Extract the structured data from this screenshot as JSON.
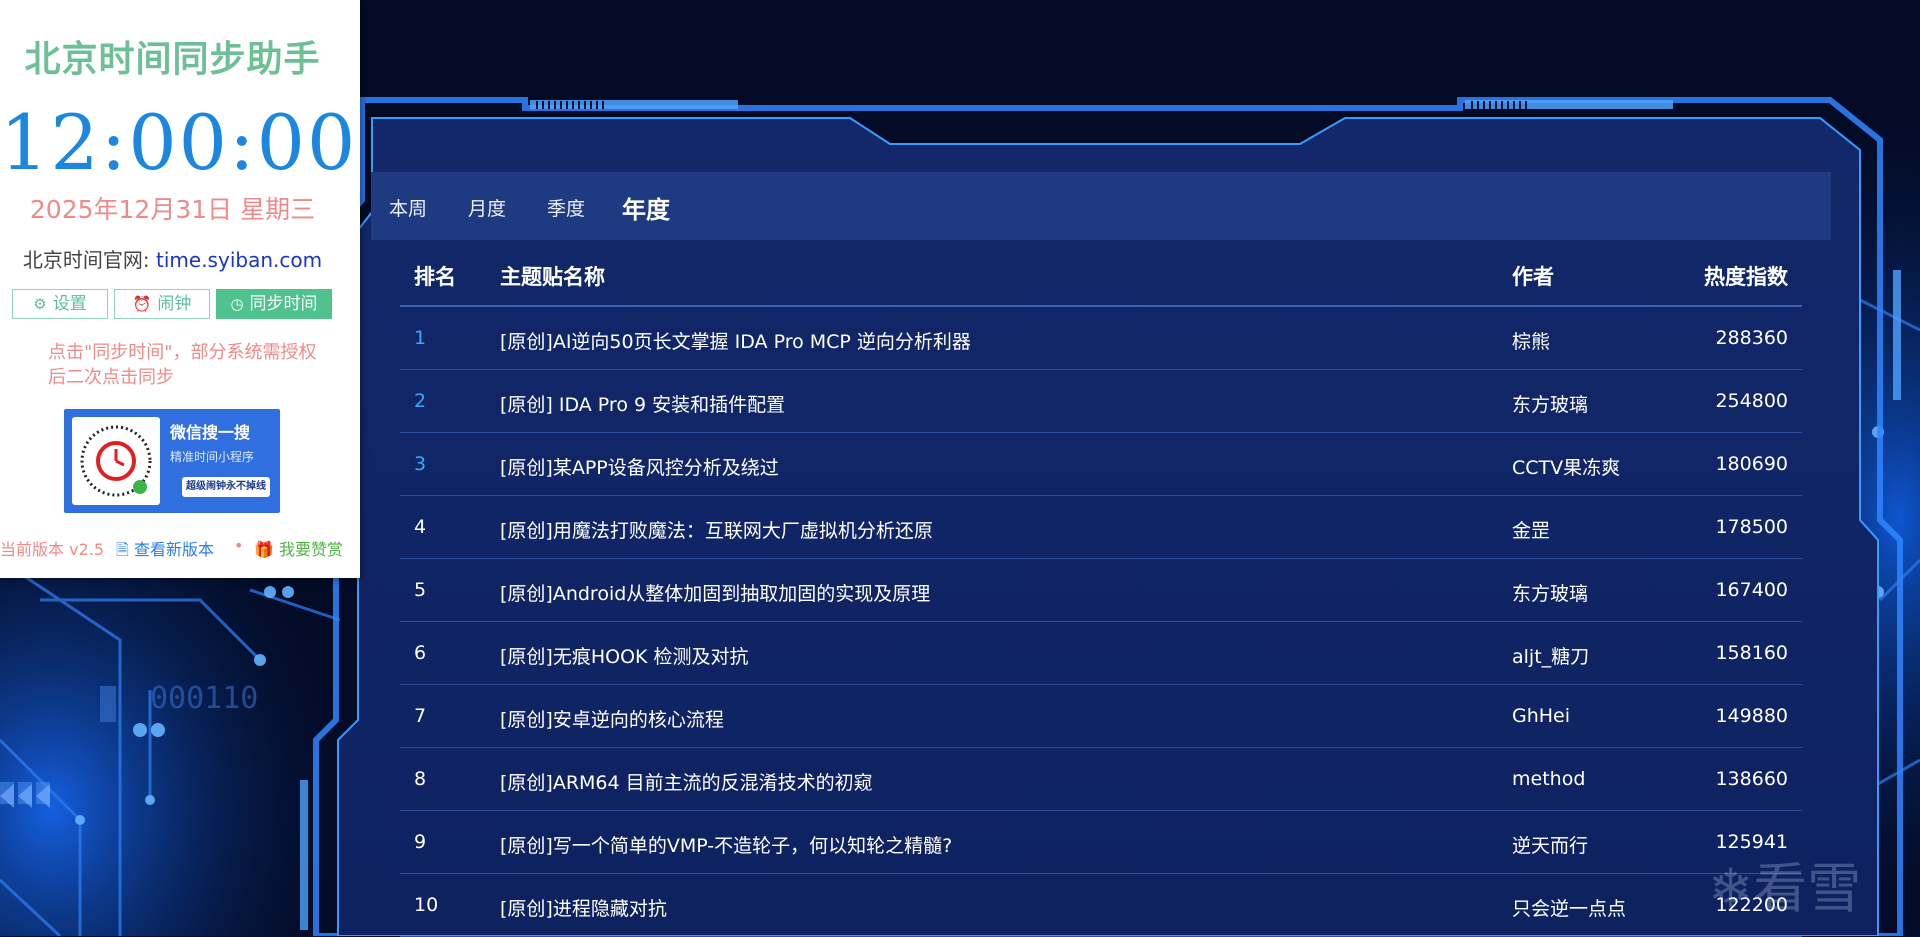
{
  "clock": {
    "title": "北京时间同步助手",
    "time": "12:00:00",
    "date": "2025年12月31日 星期三",
    "site_label": "北京时间官网: ",
    "site_link": "time.syiban.com",
    "buttons": {
      "settings": "设置",
      "alarm": "闹钟",
      "sync": "同步时间"
    },
    "note": "点击\"同步时间\"，部分系统需授权后二次点击同步",
    "qr": {
      "title": "微信搜一搜",
      "subtitle": "精准时间小程序",
      "badge": "超级闹钟永不掉线"
    },
    "footer": {
      "version": "当前版本 v2.5",
      "new_version": "查看新版本",
      "dot": "•",
      "donate": "我要赞赏"
    }
  },
  "tabs": [
    {
      "label": "本周",
      "active": false
    },
    {
      "label": "月度",
      "active": false
    },
    {
      "label": "季度",
      "active": false
    },
    {
      "label": "年度",
      "active": true
    }
  ],
  "table": {
    "headers": {
      "rank": "排名",
      "title": "主题贴名称",
      "author": "作者",
      "heat": "热度指数"
    },
    "rows": [
      {
        "rank": "1",
        "title": "[原创]AI逆向50页长文掌握 IDA Pro MCP 逆向分析利器",
        "author": "棕熊",
        "heat": "288360"
      },
      {
        "rank": "2",
        "title": "[原创] IDA Pro 9 安装和插件配置",
        "author": "东方玻璃",
        "heat": "254800"
      },
      {
        "rank": "3",
        "title": "[原创]某APP设备风控分析及绕过",
        "author": "CCTV果冻爽",
        "heat": "180690"
      },
      {
        "rank": "4",
        "title": "[原创]用魔法打败魔法：互联网大厂虚拟机分析还原",
        "author": "金罡",
        "heat": "178500"
      },
      {
        "rank": "5",
        "title": "[原创]Android从整体加固到抽取加固的实现及原理",
        "author": "东方玻璃",
        "heat": "167400"
      },
      {
        "rank": "6",
        "title": "[原创]无痕HOOK 检测及对抗",
        "author": "aljt_糖刀",
        "heat": "158160"
      },
      {
        "rank": "7",
        "title": "[原创]安卓逆向的核心流程",
        "author": "GhHei",
        "heat": "149880"
      },
      {
        "rank": "8",
        "title": "[原创]ARM64 目前主流的反混淆技术的初窥",
        "author": "method",
        "heat": "138660"
      },
      {
        "rank": "9",
        "title": "[原创]写一个简单的VMP-不造轮子，何以知轮之精髓?",
        "author": "逆天而行",
        "heat": "125941"
      },
      {
        "rank": "10",
        "title": "[原创]进程隐藏对抗",
        "author": "只会逆一点点",
        "heat": "122200"
      }
    ]
  },
  "watermark": "看雪",
  "colors": {
    "background": "#041033",
    "panel": "#14296a",
    "frame": "#3a8cff",
    "accent_rank": "#3ea6ff",
    "clock_green": "#6dbf95",
    "clock_blue": "#1d87e0",
    "clock_pink": "#ef8a8a"
  }
}
